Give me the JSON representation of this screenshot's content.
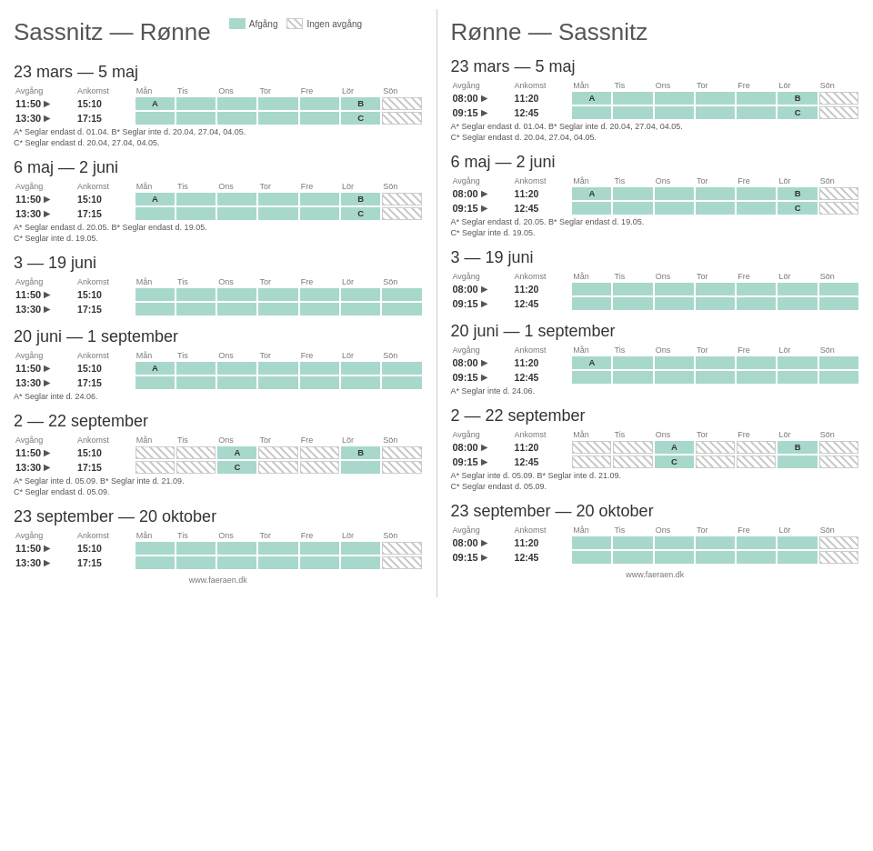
{
  "left": {
    "title": "Sassnitz — Rønne",
    "legend": {
      "solid_label": "Afgång",
      "hatched_label": "Ingen avgång"
    },
    "sections": [
      {
        "period": "23 mars — 5 maj",
        "rows": [
          {
            "dep": "11:50",
            "arr": "15:10",
            "days": [
              "A",
              "",
              "",
              "",
              "",
              "B",
              ""
            ]
          },
          {
            "dep": "13:30",
            "arr": "17:15",
            "days": [
              "",
              "",
              "",
              "",
              "",
              "C",
              ""
            ]
          }
        ],
        "notes": [
          "A* Seglar endast d. 01.04.        B* Seglar inte d. 20.04, 27.04, 04.05.",
          "C* Seglar endast d. 20.04, 27.04, 04.05."
        ]
      },
      {
        "period": "6 maj — 2 juni",
        "rows": [
          {
            "dep": "11:50",
            "arr": "15:10",
            "days": [
              "A",
              "",
              "",
              "",
              "",
              "B",
              ""
            ]
          },
          {
            "dep": "13:30",
            "arr": "17:15",
            "days": [
              "",
              "",
              "",
              "",
              "",
              "C",
              ""
            ]
          }
        ],
        "notes": [
          "A* Seglar endast d. 20.05.        B* Seglar endast d. 19.05.",
          "C* Seglar inte d. 19.05."
        ]
      },
      {
        "period": "3 — 19 juni",
        "rows": [
          {
            "dep": "11:50",
            "arr": "15:10",
            "days": [
              "",
              "",
              "",
              "",
              "",
              "",
              ""
            ]
          },
          {
            "dep": "13:30",
            "arr": "17:15",
            "days": [
              "",
              "",
              "",
              "",
              "",
              "",
              ""
            ]
          }
        ],
        "notes": []
      },
      {
        "period": "20 juni — 1 september",
        "rows": [
          {
            "dep": "11:50",
            "arr": "15:10",
            "days": [
              "A",
              "",
              "",
              "",
              "",
              "",
              ""
            ]
          },
          {
            "dep": "13:30",
            "arr": "17:15",
            "days": [
              "",
              "",
              "",
              "",
              "",
              "",
              ""
            ]
          }
        ],
        "notes": [
          "A* Seglar inte d. 24.06."
        ]
      },
      {
        "period": "2 — 22 september",
        "rows": [
          {
            "dep": "11:50",
            "arr": "15:10",
            "days": [
              "",
              "",
              "A",
              "",
              "",
              "B",
              ""
            ]
          },
          {
            "dep": "13:30",
            "arr": "17:15",
            "days": [
              "",
              "",
              "C",
              "",
              "",
              "",
              ""
            ]
          }
        ],
        "notes": [
          "A* Seglar inte d. 05.09.        B* Seglar inte d. 21.09.",
          "C* Seglar endast d. 05.09."
        ]
      },
      {
        "period": "23 september — 20 oktober",
        "rows": [
          {
            "dep": "11:50",
            "arr": "15:10",
            "days": [
              "",
              "",
              "",
              "",
              "",
              "",
              ""
            ]
          },
          {
            "dep": "13:30",
            "arr": "17:15",
            "days": [
              "",
              "",
              "",
              "",
              "",
              "",
              ""
            ]
          }
        ],
        "notes": []
      }
    ],
    "days_header": [
      "Mån",
      "Tis",
      "Ons",
      "Tor",
      "Fre",
      "Lör",
      "Sön"
    ],
    "footer": "www.faeraen.dk"
  },
  "right": {
    "title": "Rønne — Sassnitz",
    "sections": [
      {
        "period": "23 mars — 5 maj",
        "rows": [
          {
            "dep": "08:00",
            "arr": "11:20",
            "days": [
              "A",
              "",
              "",
              "",
              "",
              "B",
              ""
            ]
          },
          {
            "dep": "09:15",
            "arr": "12:45",
            "days": [
              "",
              "",
              "",
              "",
              "",
              "C",
              ""
            ]
          }
        ],
        "notes": [
          "A* Seglar endast d. 01.04.        B* Seglar inte d. 20.04, 27.04, 04.05.",
          "C* Seglar endast d. 20.04, 27.04, 04.05."
        ]
      },
      {
        "period": "6 maj — 2 juni",
        "rows": [
          {
            "dep": "08:00",
            "arr": "11:20",
            "days": [
              "A",
              "",
              "",
              "",
              "",
              "B",
              ""
            ]
          },
          {
            "dep": "09:15",
            "arr": "12:45",
            "days": [
              "",
              "",
              "",
              "",
              "",
              "C",
              ""
            ]
          }
        ],
        "notes": [
          "A* Seglar endast d. 20.05.        B* Seglar endast d. 19.05.",
          "C* Seglar inte d. 19.05."
        ]
      },
      {
        "period": "3 — 19 juni",
        "rows": [
          {
            "dep": "08:00",
            "arr": "11:20",
            "days": [
              "",
              "",
              "",
              "",
              "",
              "",
              ""
            ]
          },
          {
            "dep": "09:15",
            "arr": "12:45",
            "days": [
              "",
              "",
              "",
              "",
              "",
              "",
              ""
            ]
          }
        ],
        "notes": []
      },
      {
        "period": "20 juni — 1 september",
        "rows": [
          {
            "dep": "08:00",
            "arr": "11:20",
            "days": [
              "A",
              "",
              "",
              "",
              "",
              "",
              ""
            ]
          },
          {
            "dep": "09:15",
            "arr": "12:45",
            "days": [
              "",
              "",
              "",
              "",
              "",
              "",
              ""
            ]
          }
        ],
        "notes": [
          "A* Seglar inte d. 24.06."
        ]
      },
      {
        "period": "2 — 22 september",
        "rows": [
          {
            "dep": "08:00",
            "arr": "11:20",
            "days": [
              "",
              "",
              "A",
              "",
              "",
              "B",
              ""
            ]
          },
          {
            "dep": "09:15",
            "arr": "12:45",
            "days": [
              "",
              "",
              "C",
              "",
              "",
              "",
              ""
            ]
          }
        ],
        "notes": [
          "A* Seglar inte d. 05.09.        B* Seglar inte d. 21.09.",
          "C* Seglar endast d. 05.09."
        ]
      },
      {
        "period": "23 september — 20 oktober",
        "rows": [
          {
            "dep": "08:00",
            "arr": "11:20",
            "days": [
              "",
              "",
              "",
              "",
              "",
              "",
              ""
            ]
          },
          {
            "dep": "09:15",
            "arr": "12:45",
            "days": [
              "",
              "",
              "",
              "",
              "",
              "",
              ""
            ]
          }
        ],
        "notes": []
      }
    ],
    "days_header": [
      "Mån",
      "Tis",
      "Ons",
      "Tor",
      "Fre",
      "Lör",
      "Sön"
    ],
    "footer": "www.faeraen.dk"
  }
}
